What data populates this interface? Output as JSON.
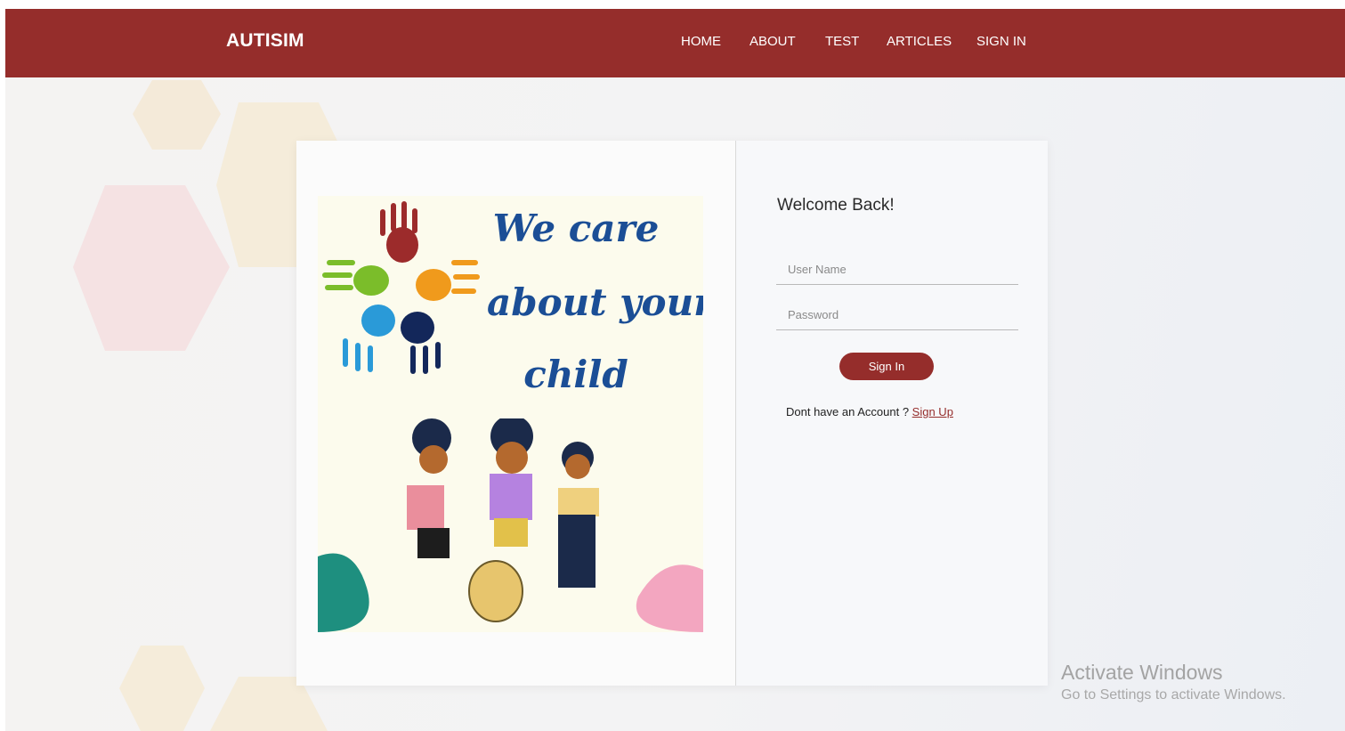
{
  "navbar": {
    "brand": "AUTISIM",
    "links": [
      "HOME",
      "ABOUT",
      "TEST",
      "ARTICLES",
      "SIGN IN"
    ]
  },
  "illustration": {
    "lines": [
      "We care",
      "about your",
      "child"
    ]
  },
  "login": {
    "title": "Welcome Back!",
    "username_placeholder": "User Name",
    "password_placeholder": "Password",
    "signin_label": "Sign In",
    "no_account_text": "Dont have an Account ?",
    "signup_label": "Sign Up"
  },
  "watermark": {
    "title": "Activate Windows",
    "subtitle": "Go to Settings to activate Windows."
  },
  "colors": {
    "brand": "#952d2b",
    "headline": "#1b4e96"
  }
}
